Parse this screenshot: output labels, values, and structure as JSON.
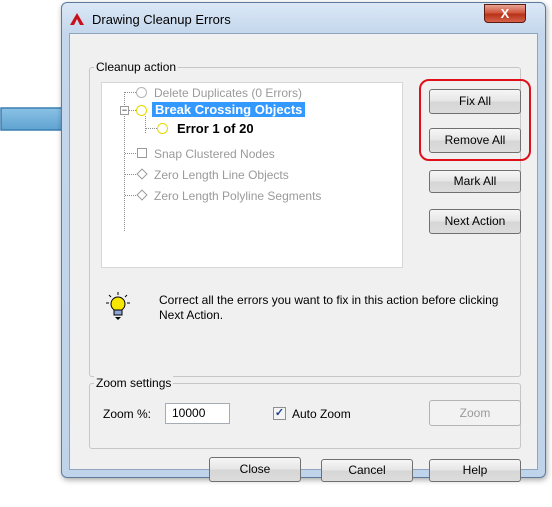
{
  "window": {
    "title": "Drawing Cleanup Errors",
    "close_glyph": "X"
  },
  "cleanup": {
    "group_label": "Cleanup action",
    "tree": [
      {
        "label": "Delete Duplicates (0 Errors)",
        "icon": "circle-icon",
        "state": "disabled"
      },
      {
        "label": "Break Crossing Objects",
        "icon": "circle-icon",
        "state": "selected",
        "expanded": true
      },
      {
        "label": "Error 1 of 20",
        "icon": "circle-icon",
        "state": "child-bold"
      },
      {
        "label": "Snap Clustered Nodes",
        "icon": "square-icon",
        "state": "disabled"
      },
      {
        "label": "Zero Length Line Objects",
        "icon": "diamond-icon",
        "state": "disabled"
      },
      {
        "label": "Zero Length Polyline Segments",
        "icon": "diamond-icon",
        "state": "disabled"
      }
    ],
    "buttons": {
      "fix_all": "Fix All",
      "remove_all": "Remove All",
      "mark_all": "Mark All",
      "next_action": "Next Action"
    },
    "hint": "Correct all the errors you want to fix in this action before clicking Next Action."
  },
  "zoom": {
    "group_label": "Zoom settings",
    "zoom_label": "Zoom %:",
    "zoom_value": "10000",
    "auto_zoom_label": "Auto Zoom",
    "auto_zoom_checked": true,
    "zoom_button": "Zoom"
  },
  "footer": {
    "close": "Close",
    "cancel": "Cancel",
    "help": "Help"
  },
  "colors": {
    "selection": "#3399ff",
    "highlight_ring": "#e0101a",
    "arrow": "#6aaedb"
  }
}
